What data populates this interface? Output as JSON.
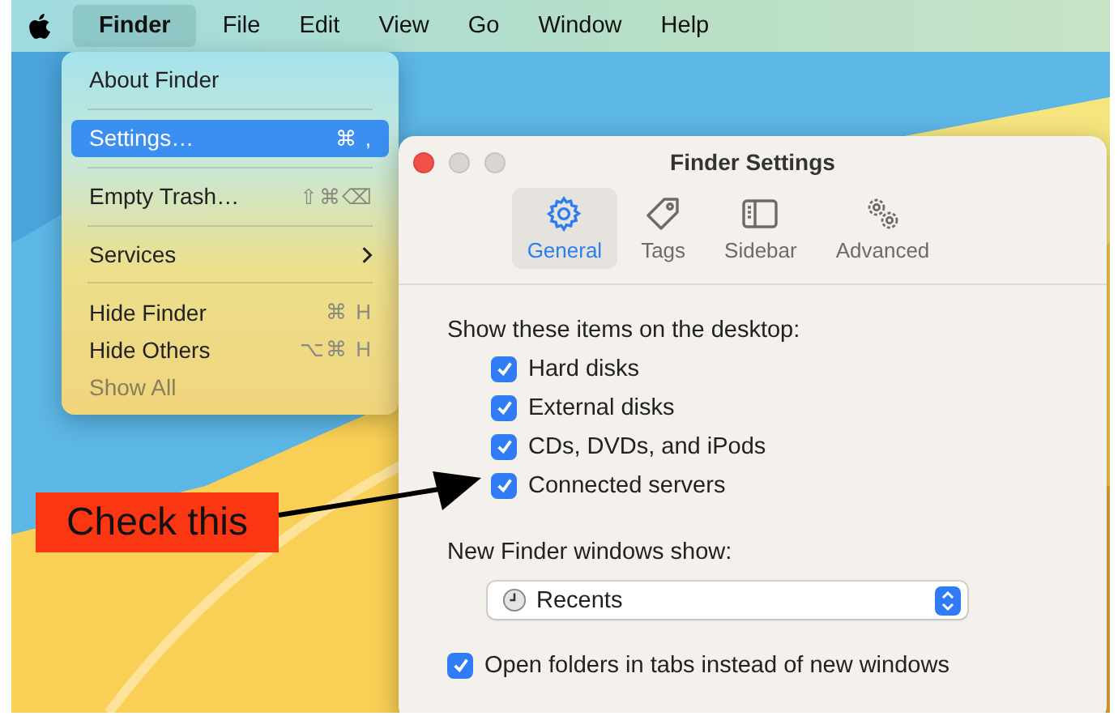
{
  "menu_bar": {
    "items": [
      {
        "label": "Finder",
        "selected": true,
        "kind": "app"
      },
      {
        "label": "File",
        "selected": false,
        "kind": "menu"
      },
      {
        "label": "Edit",
        "selected": false,
        "kind": "menu"
      },
      {
        "label": "View",
        "selected": false,
        "kind": "menu"
      },
      {
        "label": "Go",
        "selected": false,
        "kind": "menu"
      },
      {
        "label": "Window",
        "selected": false,
        "kind": "menu"
      },
      {
        "label": "Help",
        "selected": false,
        "kind": "menu"
      }
    ]
  },
  "dropdown": {
    "items": [
      {
        "kind": "item",
        "label": "About Finder",
        "selected": false,
        "disabled": false
      },
      {
        "kind": "separator"
      },
      {
        "kind": "item",
        "label": "Settings…",
        "shortcut": "⌘ ,",
        "selected": true,
        "disabled": false
      },
      {
        "kind": "separator"
      },
      {
        "kind": "item",
        "label": "Empty Trash…",
        "shortcut": "⇧⌘⌫",
        "selected": false,
        "disabled": false
      },
      {
        "kind": "separator"
      },
      {
        "kind": "submenu",
        "label": "Services",
        "selected": false,
        "disabled": false
      },
      {
        "kind": "separator"
      },
      {
        "kind": "item",
        "label": "Hide Finder",
        "shortcut": "⌘ H",
        "selected": false,
        "disabled": false
      },
      {
        "kind": "item",
        "label": "Hide Others",
        "shortcut": "⌥⌘ H",
        "selected": false,
        "disabled": false
      },
      {
        "kind": "item",
        "label": "Show All",
        "selected": false,
        "disabled": true
      }
    ]
  },
  "settings_window": {
    "title": "Finder Settings",
    "tabs": [
      {
        "label": "General",
        "kind": "gear",
        "selected": true
      },
      {
        "label": "Tags",
        "kind": "tag",
        "selected": false
      },
      {
        "label": "Sidebar",
        "kind": "sidebar",
        "selected": false
      },
      {
        "label": "Advanced",
        "kind": "gears",
        "selected": false
      }
    ],
    "desktop_items": {
      "label": "Show these items on the desktop:",
      "items": [
        {
          "label": "Hard disks",
          "checked": true
        },
        {
          "label": "External disks",
          "checked": true
        },
        {
          "label": "CDs, DVDs, and iPods",
          "checked": true
        },
        {
          "label": "Connected servers",
          "checked": true
        }
      ]
    },
    "new_windows": {
      "label": "New Finder windows show:",
      "value": "Recents"
    },
    "open_in_tabs": {
      "label": "Open folders in tabs instead of new windows",
      "checked": true
    }
  },
  "annotation": {
    "text": "Check this"
  }
}
